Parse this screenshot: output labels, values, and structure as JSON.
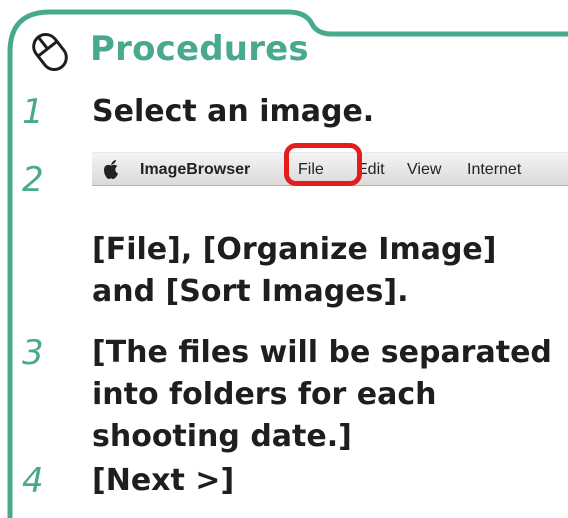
{
  "header": {
    "title": "Procedures",
    "icon": "mouse-icon"
  },
  "steps": [
    {
      "number": "1",
      "text": "Select an image."
    },
    {
      "number": "2",
      "text": "[File], [Organize Image] and [Sort Images]."
    },
    {
      "number": "3",
      "text": "[The files will be separated into folders for each shooting date.]"
    },
    {
      "number": "4",
      "text": "[Next >]"
    }
  ],
  "menubar": {
    "app_name": "ImageBrowser",
    "items": [
      "File",
      "Edit",
      "View",
      "Internet"
    ],
    "highlighted_item": "File"
  },
  "colors": {
    "accent": "#49a98f",
    "highlight": "#e21d1d",
    "text": "#1e1e1e"
  }
}
